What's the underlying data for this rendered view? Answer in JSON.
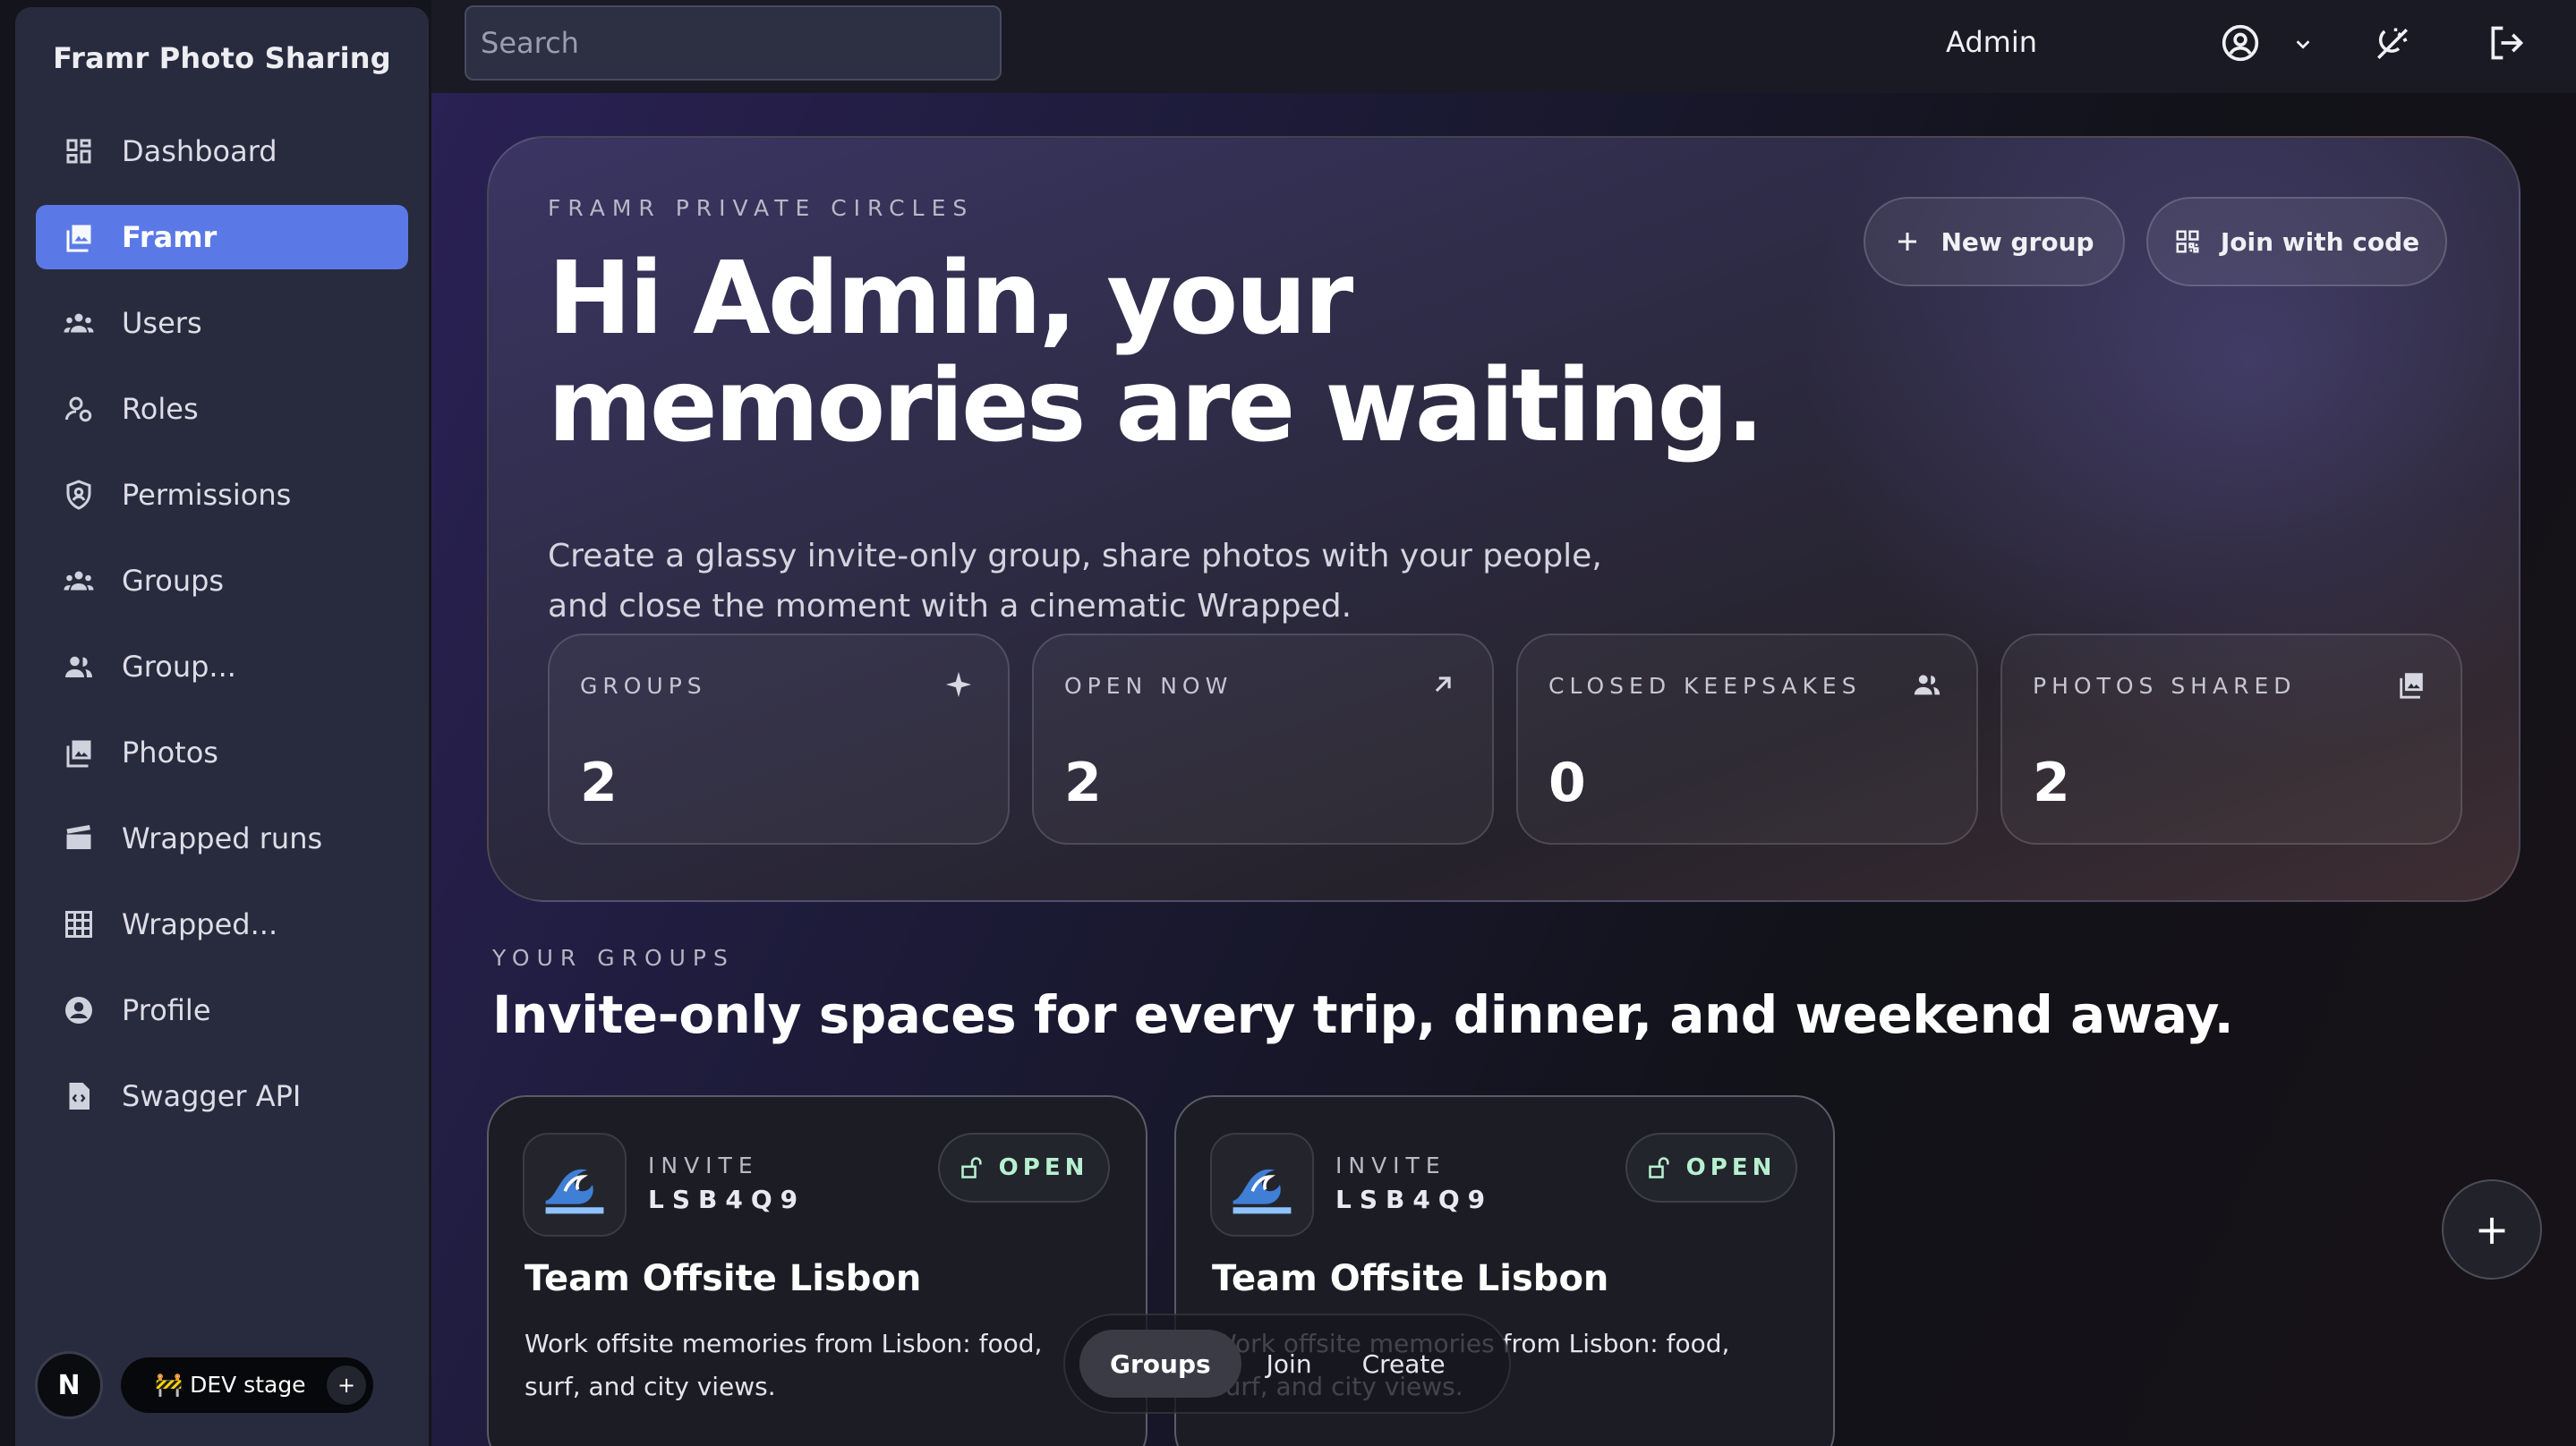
{
  "app": {
    "brand": "Framr Photo Sharing"
  },
  "sidebar": {
    "items": [
      {
        "label": "Dashboard",
        "icon": "dashboard-icon",
        "active": false
      },
      {
        "label": "Framr",
        "icon": "photo-library-icon",
        "active": true
      },
      {
        "label": "Users",
        "icon": "users-icon",
        "active": false
      },
      {
        "label": "Roles",
        "icon": "roles-icon",
        "active": false
      },
      {
        "label": "Permissions",
        "icon": "shield-icon",
        "active": false
      },
      {
        "label": "Groups",
        "icon": "groups-icon",
        "active": false
      },
      {
        "label": "Group...",
        "icon": "group-members-icon",
        "active": false
      },
      {
        "label": "Photos",
        "icon": "photos-icon",
        "active": false
      },
      {
        "label": "Wrapped runs",
        "icon": "clapperboard-icon",
        "active": false
      },
      {
        "label": "Wrapped...",
        "icon": "grid-icon",
        "active": false
      },
      {
        "label": "Profile",
        "icon": "profile-icon",
        "active": false
      },
      {
        "label": "Swagger API",
        "icon": "api-document-icon",
        "active": false
      }
    ],
    "footer": {
      "avatar_letter": "N",
      "env_label": "🚧 DEV stage",
      "env_add": "+"
    }
  },
  "topbar": {
    "search_placeholder": "Search",
    "user_name": "Admin",
    "icons": [
      "account-circle-icon",
      "chevron-down-icon",
      "theme-toggle-icon",
      "logout-icon"
    ]
  },
  "hero": {
    "eyebrow": "FRAMR PRIVATE CIRCLES",
    "title": "Hi Admin, your memories are waiting.",
    "subtitle": "Create a glassy invite-only group, share photos with your people, and close the moment with a cinematic Wrapped.",
    "new_group_label": "New group",
    "join_label": "Join with code",
    "stats": [
      {
        "label": "GROUPS",
        "value": "2",
        "icon": "sparkle-icon"
      },
      {
        "label": "OPEN NOW",
        "value": "2",
        "icon": "arrow-up-right-icon"
      },
      {
        "label": "CLOSED KEEPSAKES",
        "value": "0",
        "icon": "people-icon"
      },
      {
        "label": "PHOTOS SHARED",
        "value": "2",
        "icon": "photo-stack-icon"
      }
    ]
  },
  "groups_section": {
    "eyebrow": "YOUR GROUPS",
    "title": "Invite-only spaces for every trip, dinner, and weekend away.",
    "cards": [
      {
        "emoji": "🌊",
        "invite_label": "INVITE",
        "code": "LSB4Q9",
        "status": "OPEN",
        "title": "Team Offsite Lisbon",
        "description": "Work offsite memories from Lisbon: food, surf, and city views."
      },
      {
        "emoji": "🌊",
        "invite_label": "INVITE",
        "code": "LSB4Q9",
        "status": "OPEN",
        "title": "Team Offsite Lisbon",
        "description": "Work offsite memories from Lisbon: food, surf, and city views."
      }
    ]
  },
  "fab": {
    "label": "+"
  },
  "bottom_nav": {
    "items": [
      "Groups",
      "Join",
      "Create"
    ],
    "active": "Groups"
  },
  "colors": {
    "accent": "#5b79e6",
    "open_status": "#b7f0d0",
    "sidebar_bg": "#282b3e"
  }
}
